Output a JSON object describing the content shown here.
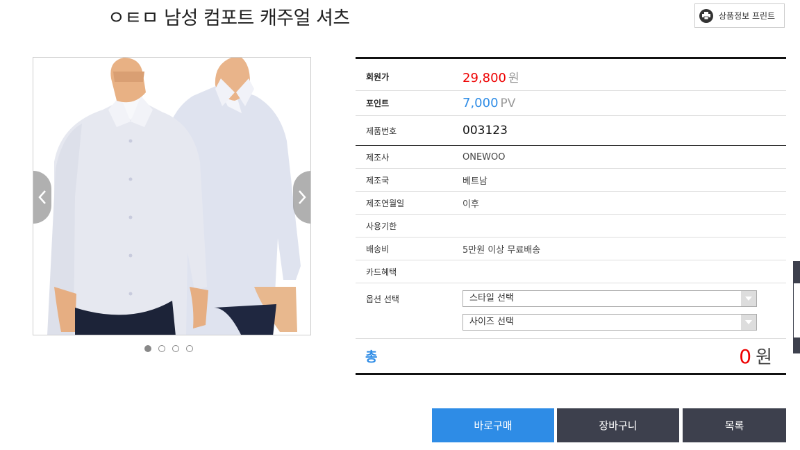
{
  "product": {
    "title": "ㅇㅌㅁ 남성 컴포트 캐주얼 셔츠"
  },
  "print_button": {
    "label": "상품정보 프린트",
    "icon": "printer-icon"
  },
  "gallery": {
    "prev_icon": "chevron-left-icon",
    "next_icon": "chevron-right-icon",
    "slide_count": 4,
    "active_slide": 1
  },
  "price": {
    "label": "회원가",
    "value": "29,800",
    "unit": "원"
  },
  "points": {
    "label": "포인트",
    "value": "7,000",
    "unit": "PV"
  },
  "code": {
    "label": "제품번호",
    "value": "003123"
  },
  "specs": [
    {
      "label": "제조사",
      "value": "ONEWOO"
    },
    {
      "label": "제조국",
      "value": "베트남"
    },
    {
      "label": "제조연월일",
      "value": "이후"
    },
    {
      "label": "사용기한",
      "value": ""
    },
    {
      "label": "배송비",
      "value": "5만원 이상 무료배송"
    },
    {
      "label": "카드혜택",
      "value": ""
    }
  ],
  "options": {
    "label": "옵션 선택",
    "style_select": "스타일 선택",
    "size_select": "사이즈 선택"
  },
  "total": {
    "label": "총",
    "amount": "0",
    "unit": "원"
  },
  "actions": {
    "buy": "바로구매",
    "cart": "장바구니",
    "list": "목록"
  },
  "colors": {
    "accent_blue": "#2e8ce6",
    "price_red": "#e00000",
    "dark_button": "#3d404d"
  }
}
